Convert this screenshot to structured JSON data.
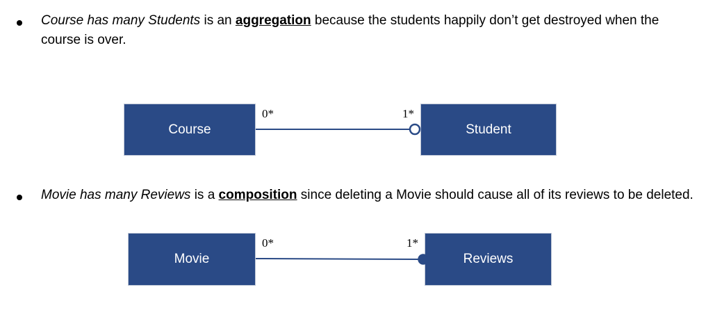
{
  "paragraph1": {
    "subject": "Course has many Students",
    "text_a": " is an ",
    "term": "aggregation",
    "text_b": " because the students happily don’t get destroyed when the course is over."
  },
  "diagram1": {
    "left_box": "Course",
    "right_box": "Student",
    "left_multiplicity": "0*",
    "right_multiplicity": "1*",
    "end_symbol": "hollow-circle"
  },
  "paragraph2": {
    "subject": "Movie has many Reviews",
    "text_a": " is a ",
    "term": "composition",
    "text_b": " since deleting a Movie should cause all of its reviews to be deleted."
  },
  "diagram2": {
    "left_box": "Movie",
    "right_box": "Reviews",
    "left_multiplicity": "0*",
    "right_multiplicity": "1*",
    "end_symbol": "filled-circle"
  },
  "colors": {
    "box_fill": "#2a4a86",
    "connector": "#2a4a86",
    "text": "#000000"
  }
}
